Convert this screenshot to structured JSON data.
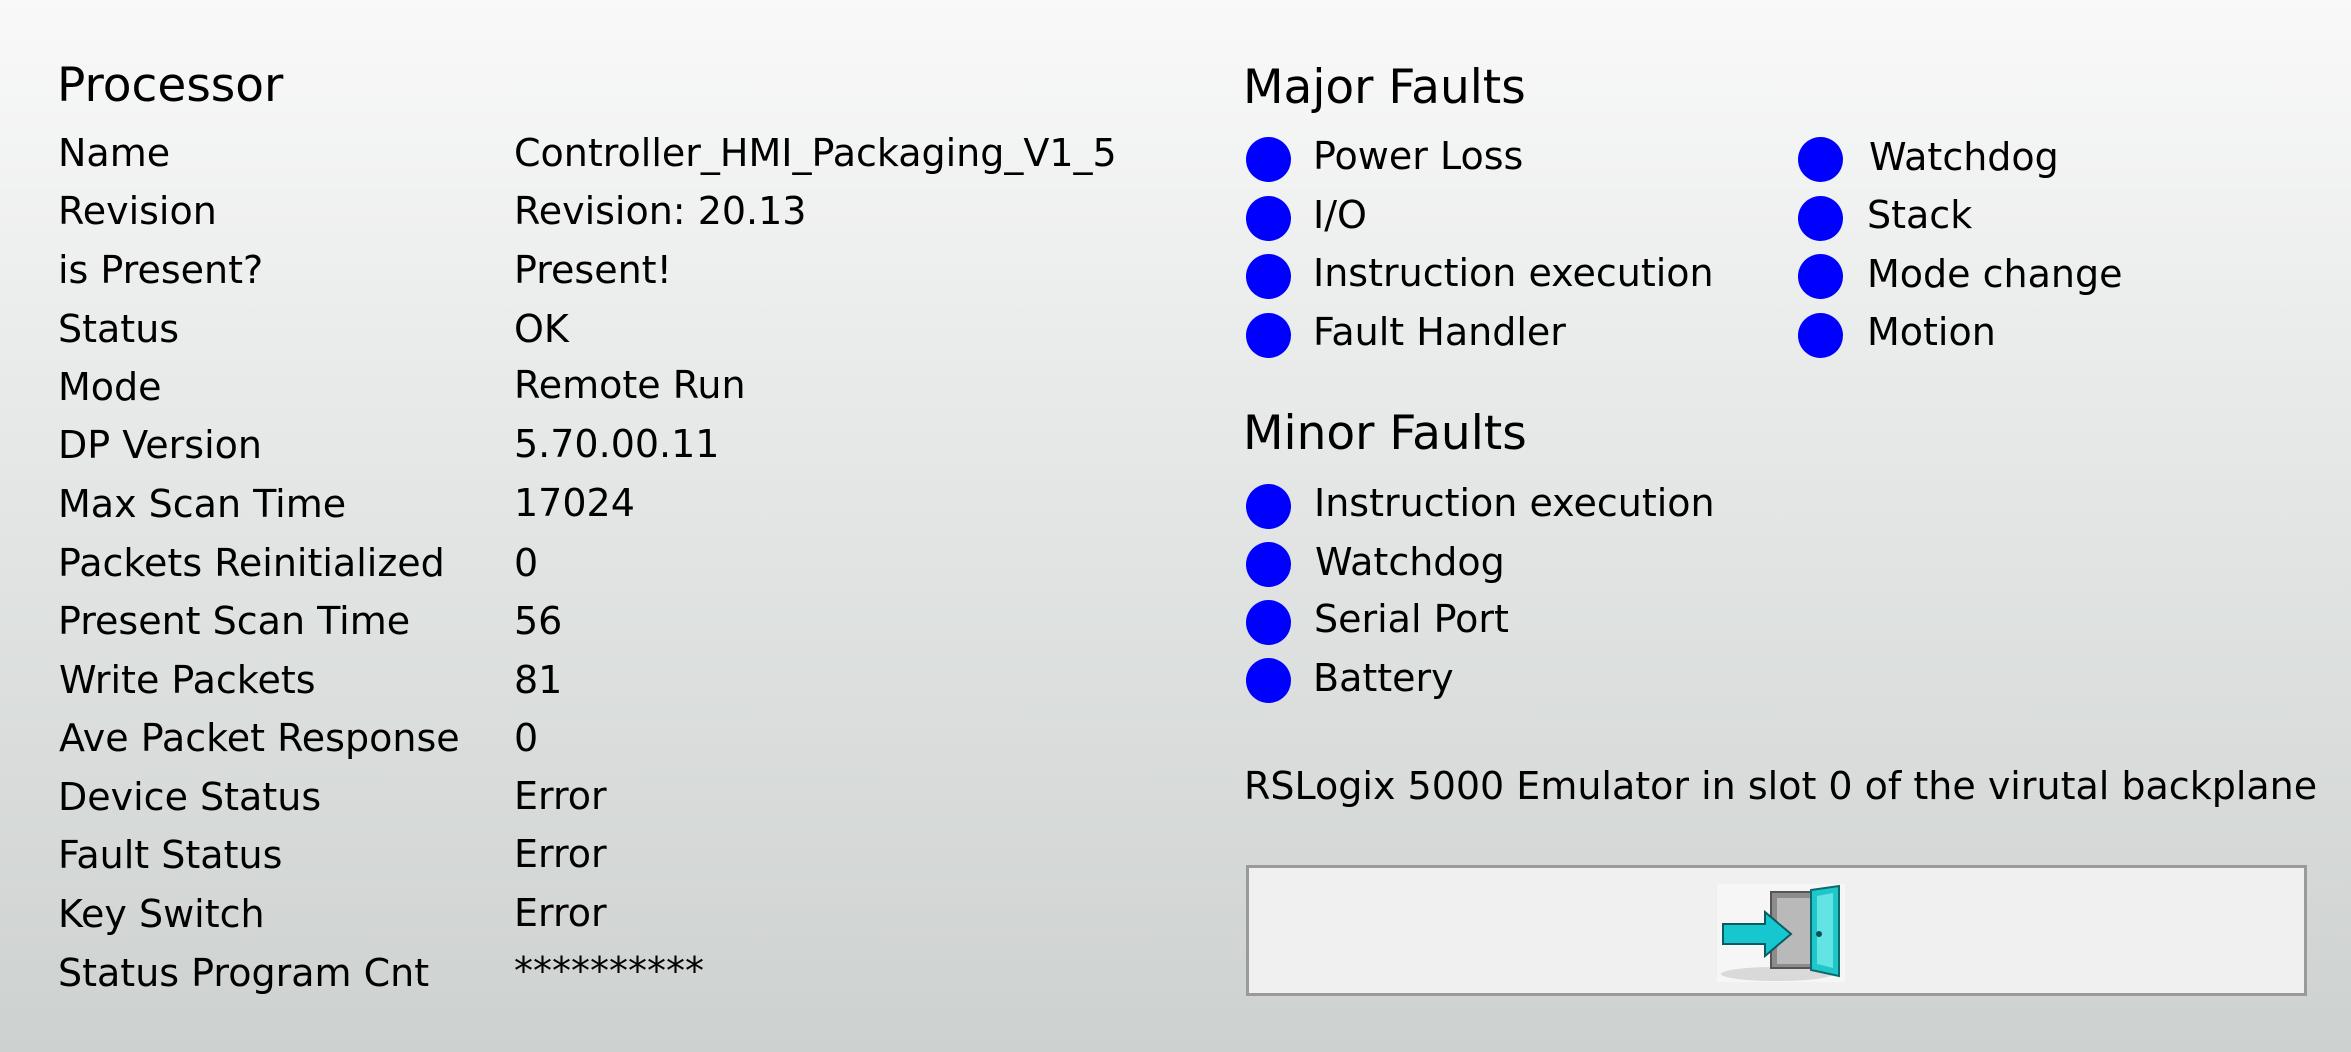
{
  "processor": {
    "heading": "Processor",
    "rows": [
      {
        "label": "Name",
        "value": "Controller_HMI_Packaging_V1_5"
      },
      {
        "label": "Revision",
        "value": "Revision: 20.13"
      },
      {
        "label": "is Present?",
        "value": "Present!"
      },
      {
        "label": "Status",
        "value": "OK"
      },
      {
        "label": "Mode",
        "value": "Remote Run"
      },
      {
        "label": "DP Version",
        "value": "5.70.00.11"
      },
      {
        "label": "Max Scan Time",
        "value": "17024"
      },
      {
        "label": "Packets Reinitialized",
        "value": "0"
      },
      {
        "label": "Present Scan Time",
        "value": "56"
      },
      {
        "label": "Write Packets",
        "value": "81"
      },
      {
        "label": "Ave Packet Response",
        "value": "0"
      },
      {
        "label": "Device Status",
        "value": "Error"
      },
      {
        "label": "Fault Status",
        "value": "Error"
      },
      {
        "label": "Key Switch",
        "value": "Error"
      },
      {
        "label": "Status Program Cnt",
        "value": "**********"
      }
    ]
  },
  "major_faults": {
    "heading": "Major Faults",
    "items": [
      {
        "label": "Power Loss"
      },
      {
        "label": "I/O"
      },
      {
        "label": "Instruction execution"
      },
      {
        "label": "Fault Handler"
      },
      {
        "label": "Watchdog"
      },
      {
        "label": "Stack"
      },
      {
        "label": "Mode change"
      },
      {
        "label": "Motion"
      }
    ]
  },
  "minor_faults": {
    "heading": "Minor Faults",
    "items": [
      {
        "label": "Instruction execution"
      },
      {
        "label": "Watchdog"
      },
      {
        "label": "Serial Port"
      },
      {
        "label": "Battery"
      }
    ]
  },
  "indicator_color": "#0000ff",
  "info_text": "RSLogix 5000 Emulator in slot 0 of the virutal backplane",
  "exit_button": {
    "icon": "exit-door-icon"
  }
}
